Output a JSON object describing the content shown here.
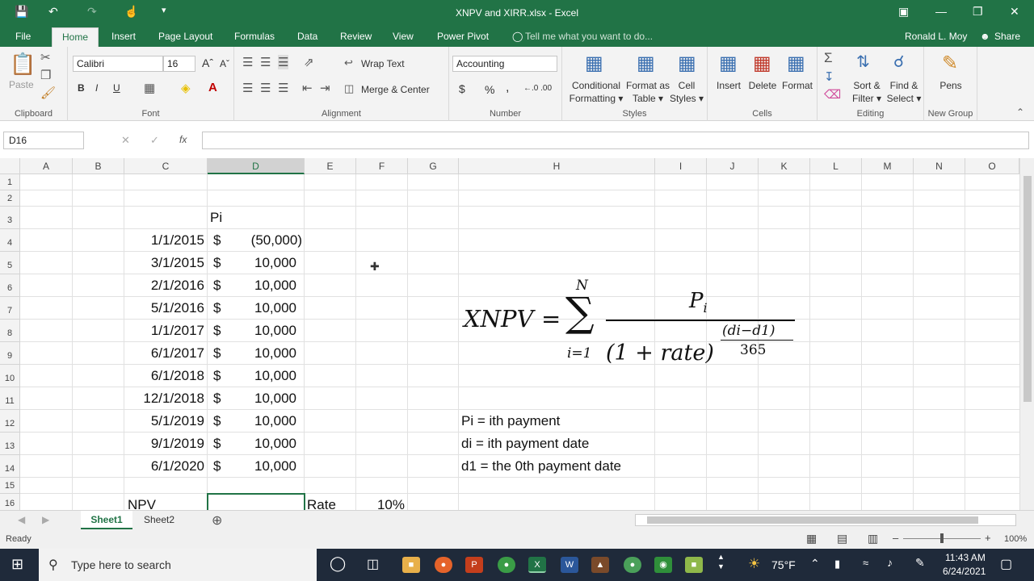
{
  "window": {
    "title": "XNPV and XIRR.xlsx - Excel"
  },
  "menu": {
    "file": "File",
    "tabs": [
      "Home",
      "Insert",
      "Page Layout",
      "Formulas",
      "Data",
      "Review",
      "View",
      "Power Pivot"
    ],
    "tell_me": "Tell me what you want to do...",
    "user": "Ronald L. Moy",
    "share": "Share"
  },
  "ribbon": {
    "clipboard": {
      "label": "Clipboard",
      "paste": "Paste"
    },
    "font": {
      "label": "Font",
      "name": "Calibri",
      "size": "16",
      "bold": "B",
      "italic": "I",
      "underline": "U"
    },
    "alignment": {
      "label": "Alignment",
      "wrap": "Wrap Text",
      "merge": "Merge & Center"
    },
    "number": {
      "label": "Number",
      "format": "Accounting",
      "currency": "$",
      "percent": "%",
      "comma": ","
    },
    "styles": {
      "label": "Styles",
      "cond1": "Conditional",
      "cond2": "Formatting",
      "fmt1": "Format as",
      "fmt2": "Table",
      "cell1": "Cell",
      "cell2": "Styles"
    },
    "cells": {
      "label": "Cells",
      "insert": "Insert",
      "delete": "Delete",
      "format": "Format"
    },
    "editing": {
      "label": "Editing",
      "sort1": "Sort &",
      "sort2": "Filter",
      "find1": "Find &",
      "find2": "Select"
    },
    "newgroup": {
      "label": "New Group",
      "pens": "Pens"
    }
  },
  "formula_bar": {
    "name_box": "D16",
    "fx": "fx",
    "content": ""
  },
  "columns": [
    "A",
    "B",
    "C",
    "D",
    "E",
    "F",
    "G",
    "H",
    "I",
    "J",
    "K",
    "L",
    "M",
    "N",
    "O"
  ],
  "rows": [
    "1",
    "2",
    "3",
    "4",
    "5",
    "6",
    "7",
    "8",
    "9",
    "10",
    "11",
    "12",
    "13",
    "14",
    "15",
    "16"
  ],
  "cells": {
    "d3": "Pi",
    "dates": [
      "1/1/2015",
      "3/1/2015",
      "2/1/2016",
      "5/1/2016",
      "1/1/2017",
      "6/1/2017",
      "6/1/2018",
      "12/1/2018",
      "5/1/2019",
      "9/1/2019",
      "6/1/2020"
    ],
    "currency": "$",
    "amounts": [
      "(50,000)",
      "10,000",
      "10,000",
      "10,000",
      "10,000",
      "10,000",
      "10,000",
      "10,000",
      "10,000",
      "10,000",
      "10,000"
    ],
    "h12": "Pi = ith payment",
    "h13": "di = ith payment date",
    "h14": "d1 = the 0th payment date",
    "c16": "NPV",
    "e16": "Rate",
    "f16": "10%"
  },
  "formula_image": {
    "lhs": "XNPV",
    "eq": "=",
    "sum": "∑",
    "upper": "N",
    "lower": "i=1",
    "numer": "P",
    "numer_sub": "i",
    "denom": "(1 + rate)",
    "exp_num": "(di−d1)",
    "exp_den": "365"
  },
  "sheets": {
    "tabs": [
      "Sheet1",
      "Sheet2"
    ],
    "active": "Sheet1"
  },
  "status": {
    "ready": "Ready",
    "zoom": "100%"
  },
  "taskbar": {
    "search": "Type here to search",
    "weather": "75°F",
    "time": "11:43 AM",
    "date": "6/24/2021"
  }
}
